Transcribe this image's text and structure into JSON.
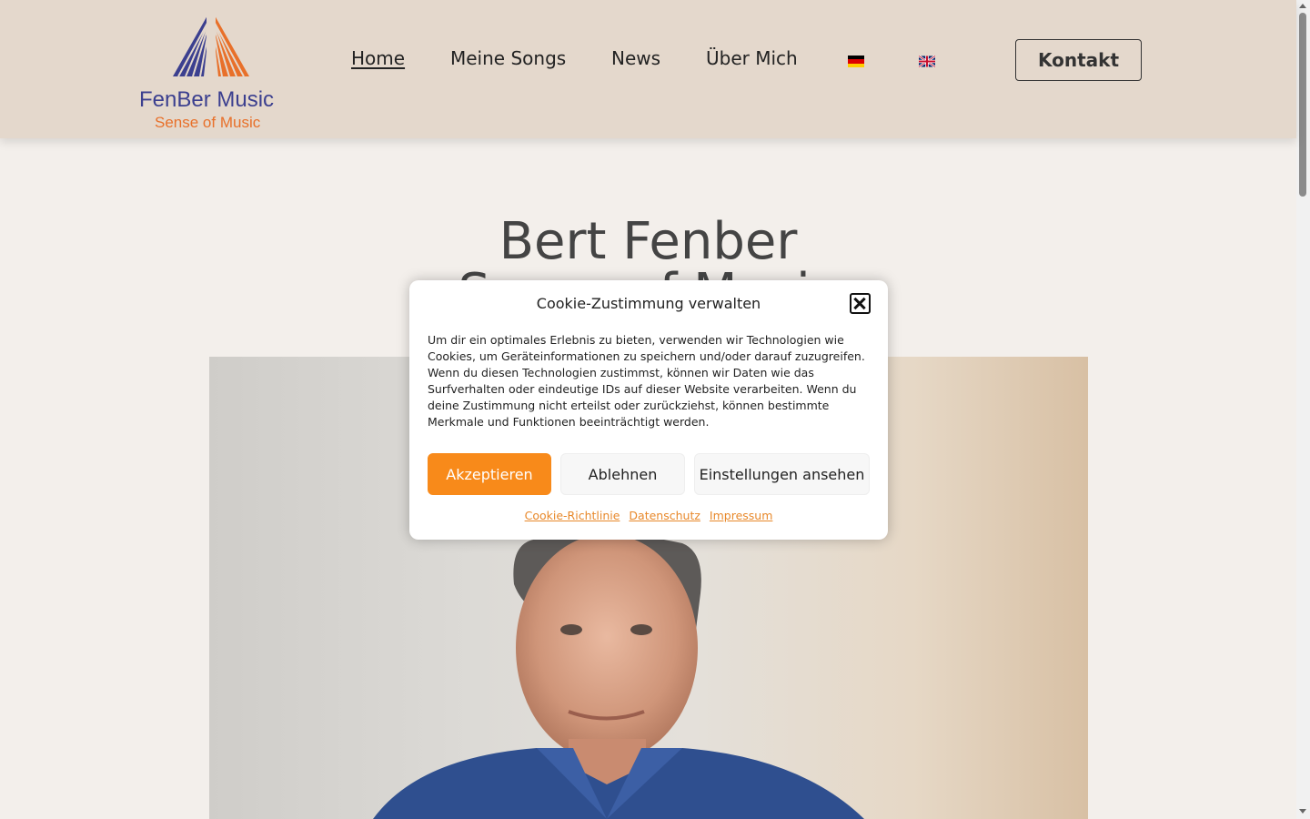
{
  "header": {
    "logo_name": "FenBer Music",
    "logo_tagline": "Sense of Music",
    "nav": [
      {
        "label": "Home",
        "active": true
      },
      {
        "label": "Meine Songs",
        "active": false
      },
      {
        "label": "News",
        "active": false
      },
      {
        "label": "Über Mich",
        "active": false
      }
    ],
    "languages": [
      "de-flag-icon",
      "uk-flag-icon"
    ],
    "contact_button": "Kontakt"
  },
  "hero": {
    "title_line1": "Bert Fenber",
    "title_line2": "Sense of Music"
  },
  "cookie": {
    "title": "Cookie-Zustimmung verwalten",
    "text": "Um dir ein optimales Erlebnis zu bieten, verwenden wir Technologien wie Cookies, um Geräteinformationen zu speichern und/oder darauf zuzugreifen. Wenn du diesen Technologien zustimmst, können wir Daten wie das Surfverhalten oder eindeutige IDs auf dieser Website verarbeiten. Wenn du deine Zustimmung nicht erteilst oder zurückziehst, können bestimmte Merkmale und Funktionen beeinträchtigt werden.",
    "accept": "Akzeptieren",
    "deny": "Ablehnen",
    "settings": "Einstellungen ansehen",
    "links": [
      "Cookie-Richtlinie",
      "Datenschutz",
      "Impressum"
    ]
  },
  "colors": {
    "header_bg": "#e4d8cc",
    "page_bg": "#f3efeb",
    "accent_orange": "#f88a1a",
    "logo_blue": "#3b3f8f"
  }
}
